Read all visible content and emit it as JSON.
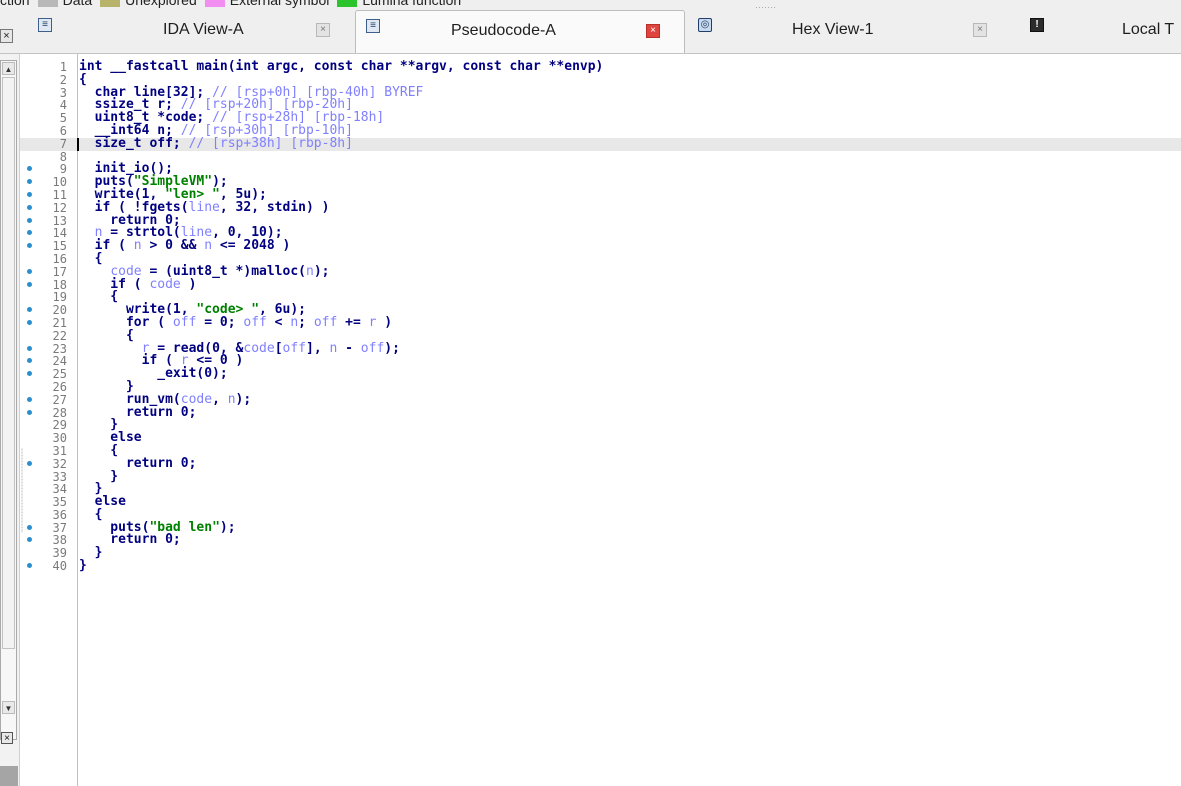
{
  "legend": {
    "items": [
      {
        "label": "ction",
        "color": ""
      },
      {
        "label": "Data",
        "color": "#b8b8b8"
      },
      {
        "label": "Unexplored",
        "color": "#b7b36a"
      },
      {
        "label": "External symbol",
        "color": "#f28ef2"
      },
      {
        "label": "Lumina function",
        "color": "#2bc42b"
      }
    ]
  },
  "tabs": [
    {
      "label": "IDA View-A",
      "icon": "document-icon",
      "close": "×",
      "active": false
    },
    {
      "label": "Pseudocode-A",
      "icon": "document-icon",
      "close": "×",
      "active": true
    },
    {
      "label": "Hex View-1",
      "icon": "hex-icon",
      "close": "×",
      "active": false
    },
    {
      "label": "Local T",
      "icon": "info-icon",
      "close": "",
      "active": false
    }
  ],
  "colors": {
    "keyword": "#000080",
    "comment": "#8080ff",
    "string": "#008000",
    "variable": "#8080ff",
    "line_dot": "#2a8fd0"
  },
  "code": {
    "current_line": 7,
    "lines": [
      {
        "n": "1",
        "dot": false,
        "segs": [
          [
            "int __fastcall main(int argc, const char **argv, const char **envp)",
            "tx"
          ]
        ]
      },
      {
        "n": "2",
        "dot": false,
        "segs": [
          [
            "{",
            "tx"
          ]
        ]
      },
      {
        "n": "3",
        "dot": false,
        "segs": [
          [
            "  char line[32]; ",
            "tx"
          ],
          [
            "// [rsp+0h] [rbp-40h] BYREF",
            "cmt"
          ]
        ]
      },
      {
        "n": "4",
        "dot": false,
        "segs": [
          [
            "  ssize_t r; ",
            "tx"
          ],
          [
            "// [rsp+20h] [rbp-20h]",
            "cmt"
          ]
        ]
      },
      {
        "n": "5",
        "dot": false,
        "segs": [
          [
            "  uint8_t *code; ",
            "tx"
          ],
          [
            "// [rsp+28h] [rbp-18h]",
            "cmt"
          ]
        ]
      },
      {
        "n": "6",
        "dot": false,
        "segs": [
          [
            "  __int64 n; ",
            "tx"
          ],
          [
            "// [rsp+30h] [rbp-10h]",
            "cmt"
          ]
        ]
      },
      {
        "n": "7",
        "dot": false,
        "segs": [
          [
            "  size_t off; ",
            "tx"
          ],
          [
            "// [rsp+38h] [rbp-8h]",
            "cmt"
          ]
        ]
      },
      {
        "n": "8",
        "dot": false,
        "segs": []
      },
      {
        "n": "9",
        "dot": true,
        "segs": [
          [
            "  init_io();",
            "tx"
          ]
        ]
      },
      {
        "n": "10",
        "dot": true,
        "segs": [
          [
            "  puts(",
            "tx"
          ],
          [
            "\"SimpleVM\"",
            "str"
          ],
          [
            ");",
            "tx"
          ]
        ]
      },
      {
        "n": "11",
        "dot": true,
        "segs": [
          [
            "  write(1, ",
            "tx"
          ],
          [
            "\"len> \"",
            "str"
          ],
          [
            ", 5u);",
            "tx"
          ]
        ]
      },
      {
        "n": "12",
        "dot": true,
        "segs": [
          [
            "  if ( !fgets(",
            "tx"
          ],
          [
            "line",
            "var"
          ],
          [
            ", 32, stdin) )",
            "tx"
          ]
        ]
      },
      {
        "n": "13",
        "dot": true,
        "segs": [
          [
            "    return 0;",
            "tx"
          ]
        ]
      },
      {
        "n": "14",
        "dot": true,
        "segs": [
          [
            "  ",
            "tx"
          ],
          [
            "n",
            "var"
          ],
          [
            " = strtol(",
            "tx"
          ],
          [
            "line",
            "var"
          ],
          [
            ", 0, 10);",
            "tx"
          ]
        ]
      },
      {
        "n": "15",
        "dot": true,
        "segs": [
          [
            "  if ( ",
            "tx"
          ],
          [
            "n",
            "var"
          ],
          [
            " > 0 && ",
            "tx"
          ],
          [
            "n",
            "var"
          ],
          [
            " <= 2048 )",
            "tx"
          ]
        ]
      },
      {
        "n": "16",
        "dot": false,
        "segs": [
          [
            "  {",
            "tx"
          ]
        ]
      },
      {
        "n": "17",
        "dot": true,
        "segs": [
          [
            "    ",
            "tx"
          ],
          [
            "code",
            "var"
          ],
          [
            " = (uint8_t *)malloc(",
            "tx"
          ],
          [
            "n",
            "var"
          ],
          [
            ");",
            "tx"
          ]
        ]
      },
      {
        "n": "18",
        "dot": true,
        "segs": [
          [
            "    if ( ",
            "tx"
          ],
          [
            "code",
            "var"
          ],
          [
            " )",
            "tx"
          ]
        ]
      },
      {
        "n": "19",
        "dot": false,
        "segs": [
          [
            "    {",
            "tx"
          ]
        ]
      },
      {
        "n": "20",
        "dot": true,
        "segs": [
          [
            "      write(1, ",
            "tx"
          ],
          [
            "\"code> \"",
            "str"
          ],
          [
            ", 6u);",
            "tx"
          ]
        ]
      },
      {
        "n": "21",
        "dot": true,
        "segs": [
          [
            "      for ( ",
            "tx"
          ],
          [
            "off",
            "var"
          ],
          [
            " = 0; ",
            "tx"
          ],
          [
            "off",
            "var"
          ],
          [
            " < ",
            "tx"
          ],
          [
            "n",
            "var"
          ],
          [
            "; ",
            "tx"
          ],
          [
            "off",
            "var"
          ],
          [
            " += ",
            "tx"
          ],
          [
            "r",
            "var"
          ],
          [
            " )",
            "tx"
          ]
        ]
      },
      {
        "n": "22",
        "dot": false,
        "segs": [
          [
            "      {",
            "tx"
          ]
        ]
      },
      {
        "n": "23",
        "dot": true,
        "segs": [
          [
            "        ",
            "tx"
          ],
          [
            "r",
            "var"
          ],
          [
            " = read(0, &",
            "tx"
          ],
          [
            "code",
            "var"
          ],
          [
            "[",
            "tx"
          ],
          [
            "off",
            "var"
          ],
          [
            "], ",
            "tx"
          ],
          [
            "n",
            "var"
          ],
          [
            " - ",
            "tx"
          ],
          [
            "off",
            "var"
          ],
          [
            ");",
            "tx"
          ]
        ]
      },
      {
        "n": "24",
        "dot": true,
        "segs": [
          [
            "        if ( ",
            "tx"
          ],
          [
            "r",
            "var"
          ],
          [
            " <= 0 )",
            "tx"
          ]
        ]
      },
      {
        "n": "25",
        "dot": true,
        "segs": [
          [
            "          _exit(0);",
            "tx"
          ]
        ]
      },
      {
        "n": "26",
        "dot": false,
        "segs": [
          [
            "      }",
            "tx"
          ]
        ]
      },
      {
        "n": "27",
        "dot": true,
        "segs": [
          [
            "      run_vm(",
            "tx"
          ],
          [
            "code",
            "var"
          ],
          [
            ", ",
            "tx"
          ],
          [
            "n",
            "var"
          ],
          [
            ");",
            "tx"
          ]
        ]
      },
      {
        "n": "28",
        "dot": true,
        "segs": [
          [
            "      return 0;",
            "tx"
          ]
        ]
      },
      {
        "n": "29",
        "dot": false,
        "segs": [
          [
            "    }",
            "tx"
          ]
        ]
      },
      {
        "n": "30",
        "dot": false,
        "segs": [
          [
            "    else",
            "tx"
          ]
        ]
      },
      {
        "n": "31",
        "dot": false,
        "segs": [
          [
            "    {",
            "tx"
          ]
        ]
      },
      {
        "n": "32",
        "dot": true,
        "segs": [
          [
            "      return 0;",
            "tx"
          ]
        ]
      },
      {
        "n": "33",
        "dot": false,
        "segs": [
          [
            "    }",
            "tx"
          ]
        ]
      },
      {
        "n": "34",
        "dot": false,
        "segs": [
          [
            "  }",
            "tx"
          ]
        ]
      },
      {
        "n": "35",
        "dot": false,
        "segs": [
          [
            "  else",
            "tx"
          ]
        ]
      },
      {
        "n": "36",
        "dot": false,
        "segs": [
          [
            "  {",
            "tx"
          ]
        ]
      },
      {
        "n": "37",
        "dot": true,
        "segs": [
          [
            "    puts(",
            "tx"
          ],
          [
            "\"bad len\"",
            "str"
          ],
          [
            ");",
            "tx"
          ]
        ]
      },
      {
        "n": "38",
        "dot": true,
        "segs": [
          [
            "    return 0;",
            "tx"
          ]
        ]
      },
      {
        "n": "39",
        "dot": false,
        "segs": [
          [
            "  }",
            "tx"
          ]
        ]
      },
      {
        "n": "40",
        "dot": true,
        "segs": [
          [
            "}",
            "tx"
          ]
        ]
      }
    ]
  }
}
